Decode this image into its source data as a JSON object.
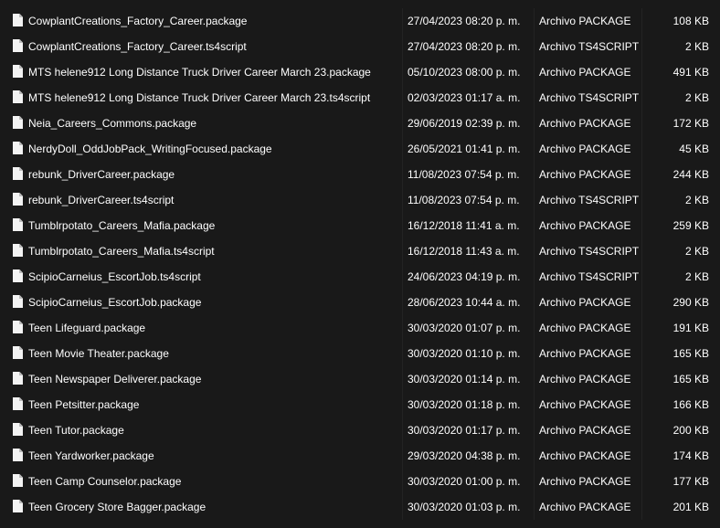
{
  "files": [
    {
      "name": "CowplantCreations_Factory_Career.package",
      "date": "27/04/2023 08:20 p. m.",
      "type": "Archivo PACKAGE",
      "size": "108 KB",
      "icon": "file-icon"
    },
    {
      "name": "CowplantCreations_Factory_Career.ts4script",
      "date": "27/04/2023 08:20 p. m.",
      "type": "Archivo TS4SCRIPT",
      "size": "2 KB",
      "icon": "file-icon"
    },
    {
      "name": "MTS helene912 Long Distance Truck Driver Career March 23.package",
      "date": "05/10/2023 08:00 p. m.",
      "type": "Archivo PACKAGE",
      "size": "491 KB",
      "icon": "file-icon"
    },
    {
      "name": "MTS helene912 Long Distance Truck Driver Career March 23.ts4script",
      "date": "02/03/2023 01:17 a. m.",
      "type": "Archivo TS4SCRIPT",
      "size": "2 KB",
      "icon": "file-icon"
    },
    {
      "name": "Neia_Careers_Commons.package",
      "date": "29/06/2019 02:39 p. m.",
      "type": "Archivo PACKAGE",
      "size": "172 KB",
      "icon": "file-icon"
    },
    {
      "name": "NerdyDoll_OddJobPack_WritingFocused.package",
      "date": "26/05/2021 01:41 p. m.",
      "type": "Archivo PACKAGE",
      "size": "45 KB",
      "icon": "file-icon"
    },
    {
      "name": "rebunk_DriverCareer.package",
      "date": "11/08/2023 07:54 p. m.",
      "type": "Archivo PACKAGE",
      "size": "244 KB",
      "icon": "file-icon"
    },
    {
      "name": "rebunk_DriverCareer.ts4script",
      "date": "11/08/2023 07:54 p. m.",
      "type": "Archivo TS4SCRIPT",
      "size": "2 KB",
      "icon": "file-icon"
    },
    {
      "name": "Tumblrpotato_Careers_Mafia.package",
      "date": "16/12/2018 11:41 a. m.",
      "type": "Archivo PACKAGE",
      "size": "259 KB",
      "icon": "file-icon"
    },
    {
      "name": "Tumblrpotato_Careers_Mafia.ts4script",
      "date": "16/12/2018 11:43 a. m.",
      "type": "Archivo TS4SCRIPT",
      "size": "2 KB",
      "icon": "file-icon"
    },
    {
      "name": "ScipioCarneius_EscortJob.ts4script",
      "date": "24/06/2023 04:19 p. m.",
      "type": "Archivo TS4SCRIPT",
      "size": "2 KB",
      "icon": "file-icon"
    },
    {
      "name": "ScipioCarneius_EscortJob.package",
      "date": "28/06/2023 10:44 a. m.",
      "type": "Archivo PACKAGE",
      "size": "290 KB",
      "icon": "file-icon"
    },
    {
      "name": "Teen Lifeguard.package",
      "date": "30/03/2020 01:07 p. m.",
      "type": "Archivo PACKAGE",
      "size": "191 KB",
      "icon": "file-icon"
    },
    {
      "name": "Teen Movie Theater.package",
      "date": "30/03/2020 01:10 p. m.",
      "type": "Archivo PACKAGE",
      "size": "165 KB",
      "icon": "file-icon"
    },
    {
      "name": "Teen Newspaper Deliverer.package",
      "date": "30/03/2020 01:14 p. m.",
      "type": "Archivo PACKAGE",
      "size": "165 KB",
      "icon": "file-icon"
    },
    {
      "name": "Teen Petsitter.package",
      "date": "30/03/2020 01:18 p. m.",
      "type": "Archivo PACKAGE",
      "size": "166 KB",
      "icon": "file-icon"
    },
    {
      "name": "Teen Tutor.package",
      "date": "30/03/2020 01:17 p. m.",
      "type": "Archivo PACKAGE",
      "size": "200 KB",
      "icon": "file-icon"
    },
    {
      "name": "Teen Yardworker.package",
      "date": "29/03/2020 04:38 p. m.",
      "type": "Archivo PACKAGE",
      "size": "174 KB",
      "icon": "file-icon"
    },
    {
      "name": "Teen Camp Counselor.package",
      "date": "30/03/2020 01:00 p. m.",
      "type": "Archivo PACKAGE",
      "size": "177 KB",
      "icon": "file-icon"
    },
    {
      "name": "Teen Grocery Store Bagger.package",
      "date": "30/03/2020 01:03 p. m.",
      "type": "Archivo PACKAGE",
      "size": "201 KB",
      "icon": "file-icon"
    }
  ],
  "colors": {
    "background": "#191919",
    "text": "#ffffff",
    "icon": "#f3f3f3"
  }
}
